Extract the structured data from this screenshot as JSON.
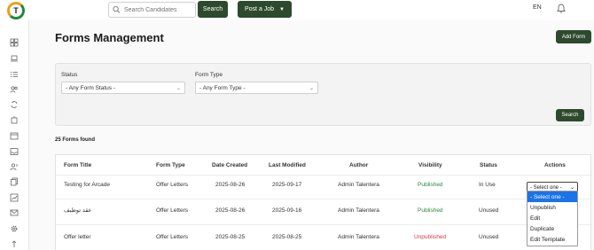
{
  "header": {
    "logo_letter": "T",
    "search_placeholder": "Search Candidates",
    "search_button": "Search",
    "post_job_button": "Post a Job",
    "language": "EN"
  },
  "page": {
    "title": "Forms Management",
    "add_form_button": "Add Form",
    "found_text": "25 Forms found"
  },
  "filters": {
    "status_label": "Status",
    "status_value": "- Any Form Status -",
    "type_label": "Form Type",
    "type_value": "- Any Form Type -",
    "search_button": "Search"
  },
  "table": {
    "headers": [
      "Form Title",
      "Form Type",
      "Date Created",
      "Last Modified",
      "Author",
      "Visibility",
      "Status",
      "Actions"
    ],
    "rows": [
      {
        "title": "Testing for Arcade",
        "type": "Offer Letters",
        "created": "2025-08-26",
        "modified": "2025-09-17",
        "author": "Admin Talentera",
        "visibility": "Published",
        "status": "In Use"
      },
      {
        "title": "عقد توظيف",
        "type": "Offer Letters",
        "created": "2025-08-26",
        "modified": "2025-09-16",
        "author": "Admin Talentera",
        "visibility": "Published",
        "status": "Unused"
      },
      {
        "title": "Offer letter",
        "type": "Offer Letters",
        "created": "2025-08-25",
        "modified": "2025-08-25",
        "author": "Admin Talentera",
        "visibility": "Unpublished",
        "status": "Unused"
      }
    ],
    "action_select_value": "- Select one -"
  },
  "action_dropdown": {
    "options": [
      "- Select one -",
      "Unpublish",
      "Edit",
      "Duplicate",
      "Edit Template"
    ]
  },
  "colors": {
    "brand_dark": "#2e4a2e",
    "published": "#2e8b3a",
    "unpublished": "#d23a3a",
    "selection": "#1a73e8"
  }
}
